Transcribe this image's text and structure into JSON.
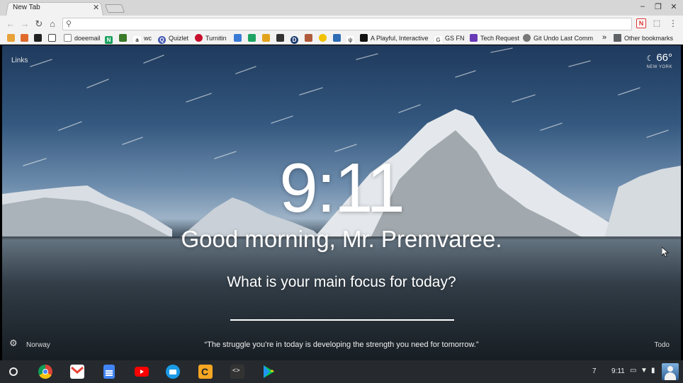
{
  "browser": {
    "tab": {
      "title": "New Tab",
      "close_glyph": "✕"
    },
    "window_controls": {
      "minimize": "‒",
      "restore": "❐",
      "close": "✕"
    },
    "toolbar": {
      "back_icon": "arrow-left-icon",
      "forward_icon": "arrow-right-icon",
      "reload_icon": "reload-icon",
      "home_icon": "home-icon",
      "omnibox_value": "",
      "menu_icon": "more-vert-icon"
    },
    "bookmarks": [
      {
        "label": "",
        "icon": "bookmark-icon-1",
        "color": "#e8a23a"
      },
      {
        "label": "",
        "icon": "bookmark-icon-2",
        "color": "#e06a2c"
      },
      {
        "label": "",
        "icon": "github-icon",
        "color": "#222222"
      },
      {
        "label": "",
        "icon": "codepen-icon",
        "color": "#444444"
      },
      {
        "label": "doeemail",
        "icon": "page-icon",
        "color": "#888888"
      },
      {
        "label": "",
        "icon": "bookmark-n-icon",
        "color": "#1aa260"
      },
      {
        "label": "",
        "icon": "bookmark-green-icon",
        "color": "#3b7a2a"
      },
      {
        "label": "wc",
        "icon": "amazon-icon",
        "color": "#222222"
      },
      {
        "label": "Quizlet",
        "icon": "quizlet-icon",
        "color": "#4257b2"
      },
      {
        "label": "Turnitin",
        "icon": "turnitin-icon",
        "color": "#c8102e"
      },
      {
        "label": "",
        "icon": "bookmark-24-icon",
        "color": "#3a7bd5"
      },
      {
        "label": "",
        "icon": "drive-icon",
        "color": "#1fa463"
      },
      {
        "label": "",
        "icon": "bookmark-grid-icon",
        "color": "#e2a31b"
      },
      {
        "label": "",
        "icon": "bookmark-dark-icon",
        "color": "#333333"
      },
      {
        "label": "",
        "icon": "bookmark-d-icon",
        "color": "#1b3b6f"
      },
      {
        "label": "",
        "icon": "bookmark-box-icon",
        "color": "#b05a3c"
      },
      {
        "label": "",
        "icon": "bookmark-yellow-icon",
        "color": "#f2c200"
      },
      {
        "label": "",
        "icon": "bookmark-blue-icon",
        "color": "#2e6db4"
      },
      {
        "label": "",
        "icon": "bookmark-fork-icon",
        "color": "#555555"
      },
      {
        "label": "A Playful, Interactive",
        "icon": "bookmark-black-icon",
        "color": "#111111"
      },
      {
        "label": "GS FN",
        "icon": "gs-icon",
        "color": "#666666"
      },
      {
        "label": "Tech Request",
        "icon": "forms-icon",
        "color": "#673ab7"
      },
      {
        "label": "Git Undo Last Comm",
        "icon": "git-icon",
        "color": "#555555"
      }
    ],
    "bookmarks_overflow": "»",
    "other_bookmarks": "Other bookmarks"
  },
  "momentum": {
    "links": "Links",
    "weather": {
      "temp": "66°",
      "city": "NEW YORK",
      "icon": "moon-icon"
    },
    "clock": "9:11",
    "greeting": "Good morning, Mr. Premvaree.",
    "focus_question": "What is your main focus for today?",
    "focus_input_value": "",
    "location": "Norway",
    "quote": "“The struggle you’re in today is developing the strength you need for tomorrow.”",
    "todo": "Todo",
    "settings_icon": "gear-icon"
  },
  "shelf": {
    "apps": [
      {
        "name": "chrome-app-icon",
        "color": "#db4437"
      },
      {
        "name": "gmail-app-icon",
        "color": "#ea4335"
      },
      {
        "name": "docs-app-icon",
        "color": "#4285f4"
      },
      {
        "name": "youtube-app-icon",
        "color": "#ff0000"
      },
      {
        "name": "files-app-icon",
        "color": "#1a9be6"
      },
      {
        "name": "caret-app-icon",
        "color": "#f5a623"
      },
      {
        "name": "code-app-icon",
        "color": "#333333"
      },
      {
        "name": "play-store-app-icon",
        "color": "#00c853"
      }
    ],
    "notification_count": "7",
    "time": "9:11"
  },
  "colors": {
    "toolbar_bg": "#f2f2f2",
    "shelf_bg": "#262a2e",
    "sky_top": "#1f3a5d"
  }
}
